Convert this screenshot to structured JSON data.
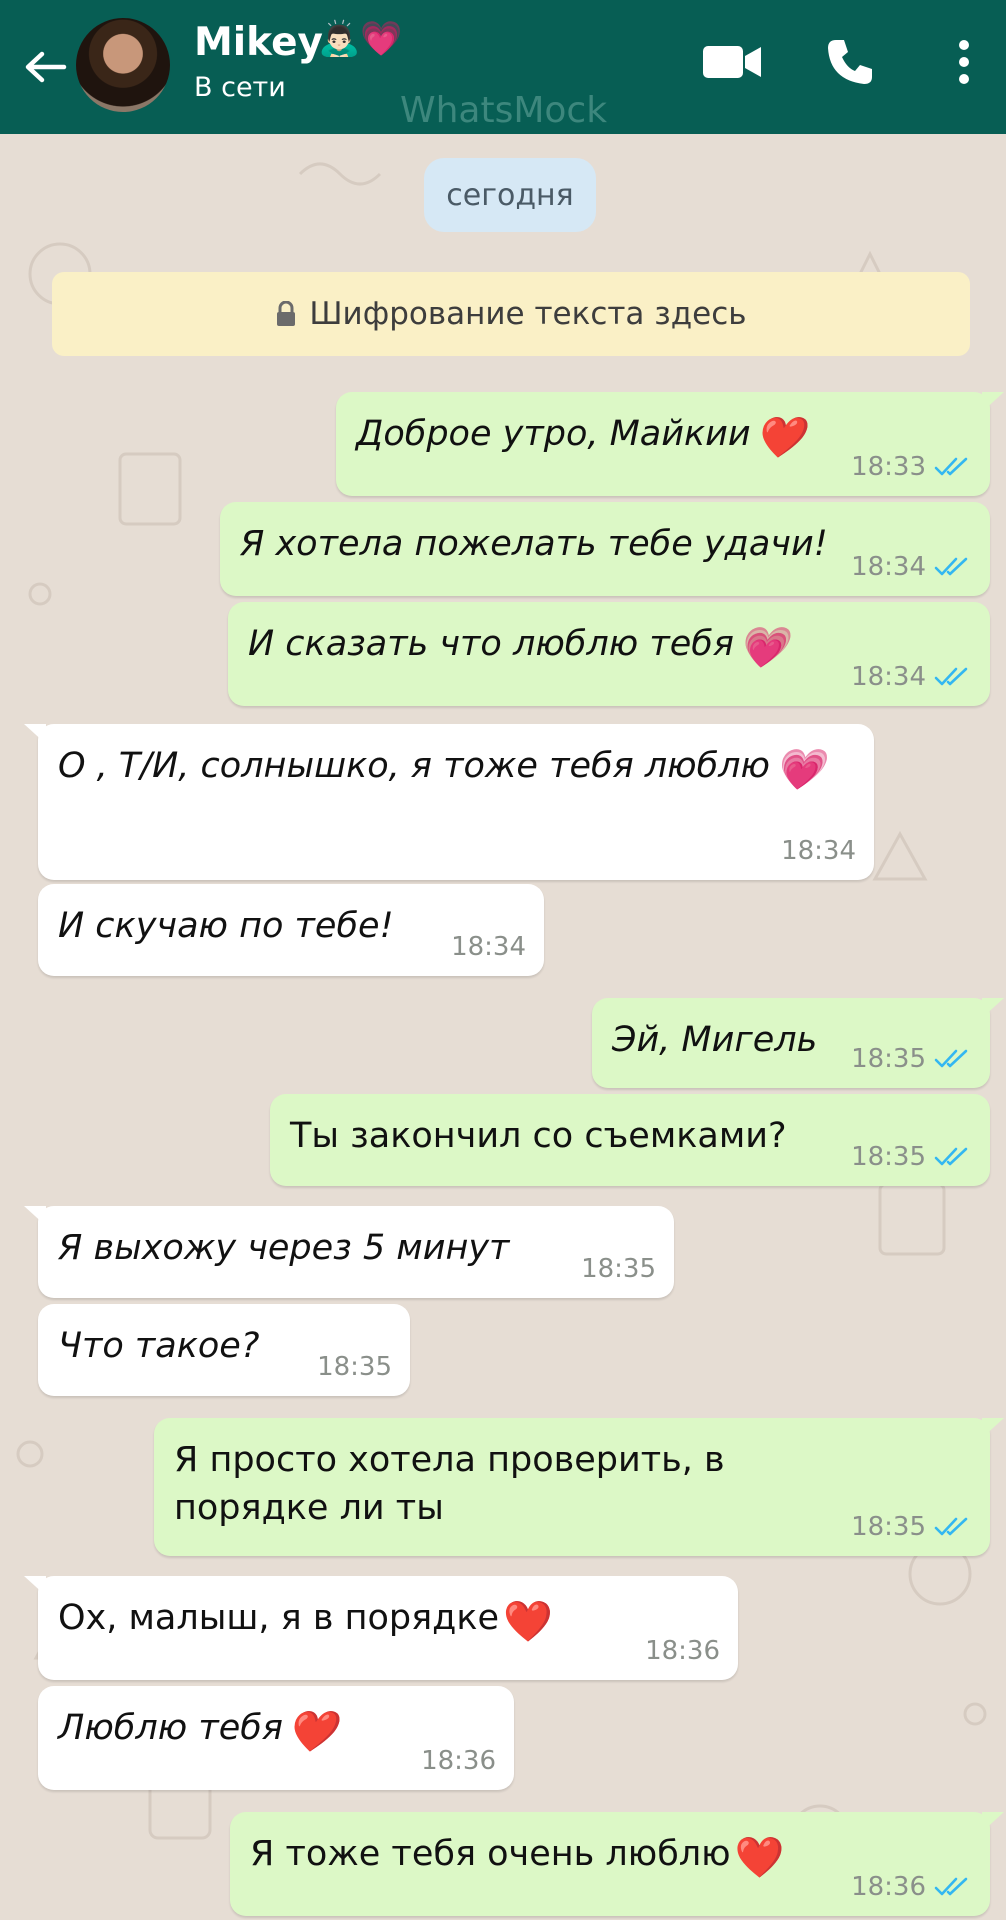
{
  "header": {
    "contact_name": "Mikey",
    "contact_emoji": "🙇🏻‍♂️💗",
    "status": "В сети",
    "watermark": "WhatsMock",
    "bg_color": "#075e54"
  },
  "chat": {
    "date_chip": "сегодня",
    "encryption_notice": "Шифрование текста здесь",
    "messages": [
      {
        "dir": "out",
        "text": "Доброе утро, Майкии",
        "emoji": "❤️",
        "time": "18:33",
        "ticks": "read"
      },
      {
        "dir": "out",
        "text": "Я хотела пожелать тебе удачи!",
        "time": "18:34",
        "ticks": "read"
      },
      {
        "dir": "out",
        "text": "И сказать что люблю тебя",
        "emoji": "💗",
        "time": "18:34",
        "ticks": "read"
      },
      {
        "dir": "in",
        "text": "О , Т/И, солнышко, я тоже тебя люблю",
        "emoji": "💗",
        "time": "18:34"
      },
      {
        "dir": "in",
        "text": "И скучаю по тебе!",
        "time": "18:34"
      },
      {
        "dir": "out",
        "text": "Эй, Мигель",
        "time": "18:35",
        "ticks": "read"
      },
      {
        "dir": "out",
        "text": "Ты закончил со съемками?",
        "time": "18:35",
        "ticks": "read"
      },
      {
        "dir": "in",
        "text": "Я выхожу через 5 минут",
        "time": "18:35"
      },
      {
        "dir": "in",
        "text": "Что такое?",
        "time": "18:35"
      },
      {
        "dir": "out",
        "text": "Я просто хотела проверить, в порядке ли ты",
        "time": "18:35",
        "ticks": "read"
      },
      {
        "dir": "in",
        "text": "Ох, малыш, я в порядке",
        "emoji": "❤️",
        "time": "18:36"
      },
      {
        "dir": "in",
        "text": "Люблю тебя",
        "emoji": "❤️",
        "time": "18:36"
      },
      {
        "dir": "out",
        "text": "Я тоже тебя очень люблю",
        "emoji": "❤️",
        "time": "18:36",
        "ticks": "read"
      }
    ]
  },
  "colors": {
    "outgoing_bubble": "#dcf8c6",
    "incoming_bubble": "#ffffff",
    "read_ticks": "#34b7f1"
  }
}
